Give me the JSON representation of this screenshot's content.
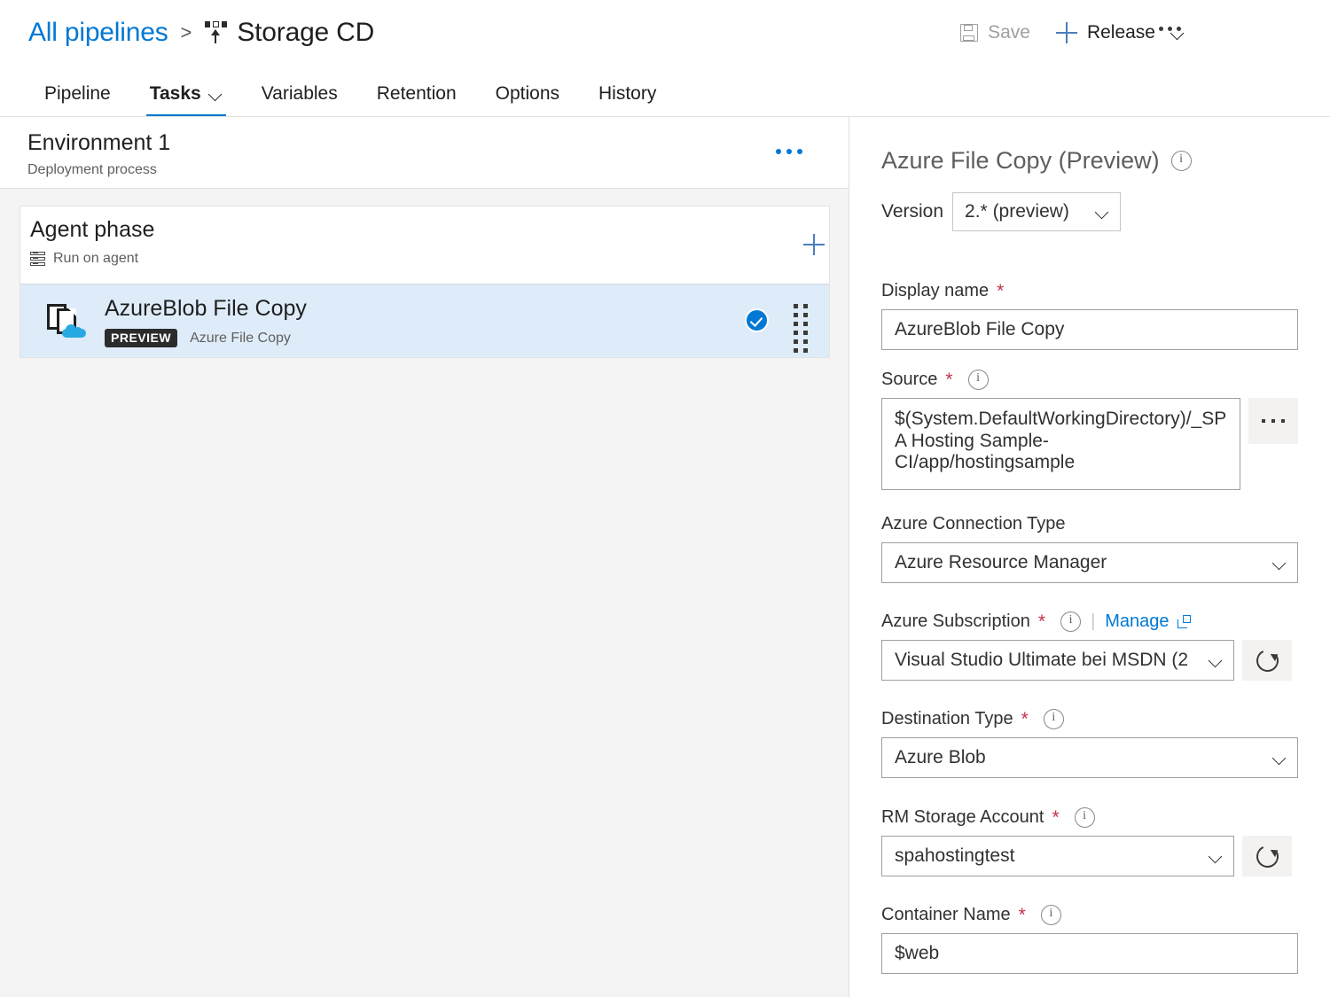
{
  "header": {
    "breadcrumb_root": "All pipelines",
    "breadcrumb_separator": ">",
    "pipeline_name": "Storage CD",
    "pipeline_icon": "release-pipeline-icon"
  },
  "toolbar": {
    "save_label": "Save",
    "save_icon": "floppy-disk-icon",
    "release_label": "Release",
    "release_icon": "plus-icon",
    "overflow_icon": "ellipsis-icon"
  },
  "tabs": [
    {
      "label": "Pipeline",
      "selected": false,
      "has_chevron": false
    },
    {
      "label": "Tasks",
      "selected": true,
      "has_chevron": true
    },
    {
      "label": "Variables",
      "selected": false,
      "has_chevron": false
    },
    {
      "label": "Retention",
      "selected": false,
      "has_chevron": false
    },
    {
      "label": "Options",
      "selected": false,
      "has_chevron": false
    },
    {
      "label": "History",
      "selected": false,
      "has_chevron": false
    }
  ],
  "left_pane": {
    "environment": {
      "title": "Environment 1",
      "subtitle": "Deployment process",
      "more_icon": "ellipsis-icon"
    },
    "phase": {
      "title": "Agent phase",
      "subtitle": "Run on agent",
      "subtitle_icon": "server-icon",
      "add_icon": "plus-icon"
    },
    "task": {
      "name": "AzureBlob File Copy",
      "badge": "PREVIEW",
      "type": "Azure File Copy",
      "icon": "file-copy-cloud-icon",
      "status_icon": "check-circle-icon",
      "drag_icon": "drag-handle-icon",
      "selected": true
    }
  },
  "right_pane": {
    "title": "Azure File Copy (Preview)",
    "title_info_icon": "info-icon",
    "version": {
      "label": "Version",
      "value": "2.* (preview)"
    },
    "fields": [
      {
        "label": "Display name",
        "required": true,
        "has_info": false,
        "control": "text",
        "value": "AzureBlob File Copy"
      },
      {
        "label": "Source",
        "required": true,
        "has_info": true,
        "control": "textarea",
        "value": "$(System.DefaultWorkingDirectory)/_SPA Hosting Sample-CI/app/hostingsample",
        "side_button": "browse-ellipsis-button"
      },
      {
        "label": "Azure Connection Type",
        "required": false,
        "has_info": false,
        "control": "select",
        "value": "Azure Resource Manager"
      },
      {
        "label": "Azure Subscription",
        "required": true,
        "has_info": true,
        "control": "select",
        "value": "Visual Studio Ultimate bei MSDN (2",
        "manage_link": "Manage",
        "manage_icon": "external-link-icon",
        "side_button": "refresh-button"
      },
      {
        "label": "Destination Type",
        "required": true,
        "has_info": true,
        "control": "select",
        "value": "Azure Blob"
      },
      {
        "label": "RM Storage Account",
        "required": true,
        "has_info": true,
        "control": "select",
        "value": "spahostingtest",
        "side_button": "refresh-button"
      },
      {
        "label": "Container Name",
        "required": true,
        "has_info": true,
        "control": "text",
        "value": "$web"
      }
    ]
  },
  "colors": {
    "accent": "#0078d4",
    "selected_row": "#deecf9",
    "required_asterisk": "#c4314b",
    "badge_bg": "#2b2b2b",
    "pane_bg": "#f4f4f4"
  }
}
